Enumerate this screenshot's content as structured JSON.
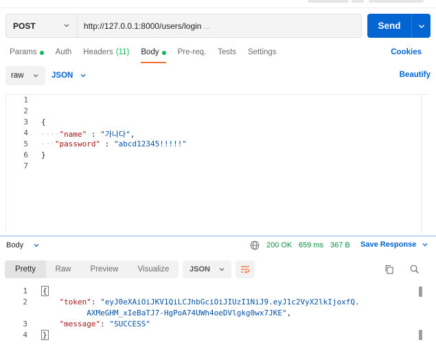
{
  "request": {
    "method": "POST",
    "url": "http://127.0.0.1:8000/users/login",
    "url_overflow": "...",
    "send_label": "Send"
  },
  "request_tabs": [
    {
      "label": "Params",
      "dot": true
    },
    {
      "label": "Auth"
    },
    {
      "label": "Headers",
      "count": "(11)"
    },
    {
      "label": "Body",
      "dot": true,
      "active": true
    },
    {
      "label": "Pre-req."
    },
    {
      "label": "Tests"
    },
    {
      "label": "Settings"
    }
  ],
  "cookies_label": "Cookies",
  "body_options": {
    "mode": "raw",
    "language": "JSON",
    "beautify_label": "Beautify"
  },
  "request_body": {
    "line_numbers": [
      "1",
      "2",
      "3",
      "4",
      "5",
      "6",
      "7"
    ],
    "open_brace": "{",
    "close_brace": "}",
    "fields": [
      {
        "key": "\"name\"",
        "sep": " : ",
        "value": "\"가나다\"",
        "trail": ","
      },
      {
        "key": "\"password\"",
        "sep": " : ",
        "value": "\"abcd12345!!!!!\"",
        "trail": ""
      }
    ]
  },
  "response": {
    "section_label": "Body",
    "status": "200 OK",
    "time": "659 ms",
    "size": "367 B",
    "save_label": "Save Response",
    "view_tabs": [
      "Pretty",
      "Raw",
      "Preview",
      "Visualize"
    ],
    "format": "JSON",
    "line_numbers": [
      "1",
      "2",
      "3",
      "4"
    ],
    "open_brace": "{",
    "close_brace": "}",
    "token_key": "\"token\"",
    "token_value_1": "\"eyJ0eXAiOiJKV1QiLCJhbGciOiJIUzI1NiJ9.eyJ1c2VyX2lkIjoxfQ.",
    "token_value_2": "AXMeGHM_xIeBaTJ7-HgPoA74UWh4oeDVlgkg0wx7JKE\"",
    "token_trail": ",",
    "message_key": "\"message\"",
    "message_value": "\"SUCCESS\""
  },
  "colors": {
    "accent": "#0265d2",
    "active_tab": "#ff6c37",
    "success": "#0cbb52",
    "json_key": "#a31515",
    "json_string": "#0451a5"
  }
}
